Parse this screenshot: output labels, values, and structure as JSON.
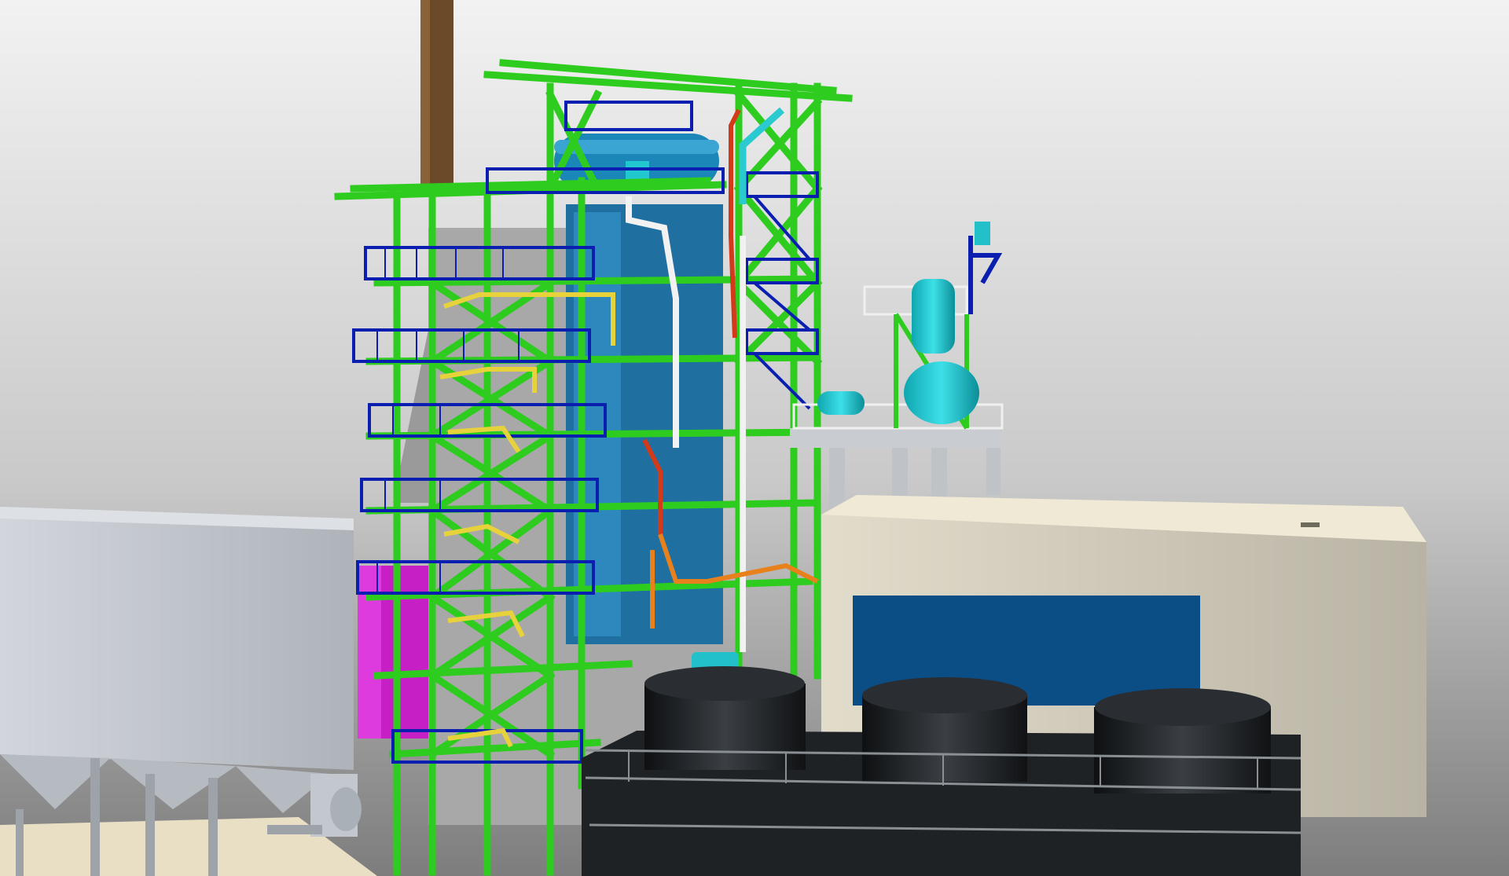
{
  "scene": {
    "description_free": true,
    "colors": {
      "background_top": "#e6e6e6",
      "background_bottom": "#8f8f8f",
      "steel_green": "#2ecc1f",
      "railing_blue": "#0a1fb0",
      "vessel_cyan": "#17c6cf",
      "boiler_blue": "#1f7fb0",
      "casing_gray": "#a7a7a7",
      "pipe_yellow": "#e8d23c",
      "pipe_red": "#d23a1a",
      "pipe_orange": "#e8801c",
      "pipe_white": "#f2f2f2",
      "magenta": "#c51fc5",
      "chimney_brown": "#6b4a2a",
      "building_cream": "#e9e3d0",
      "building_panel_blue": "#0b4d85",
      "cooler_black": "#1f2225",
      "silo_gray": "#c8cdd4",
      "ground": "#e9dfc5"
    }
  }
}
